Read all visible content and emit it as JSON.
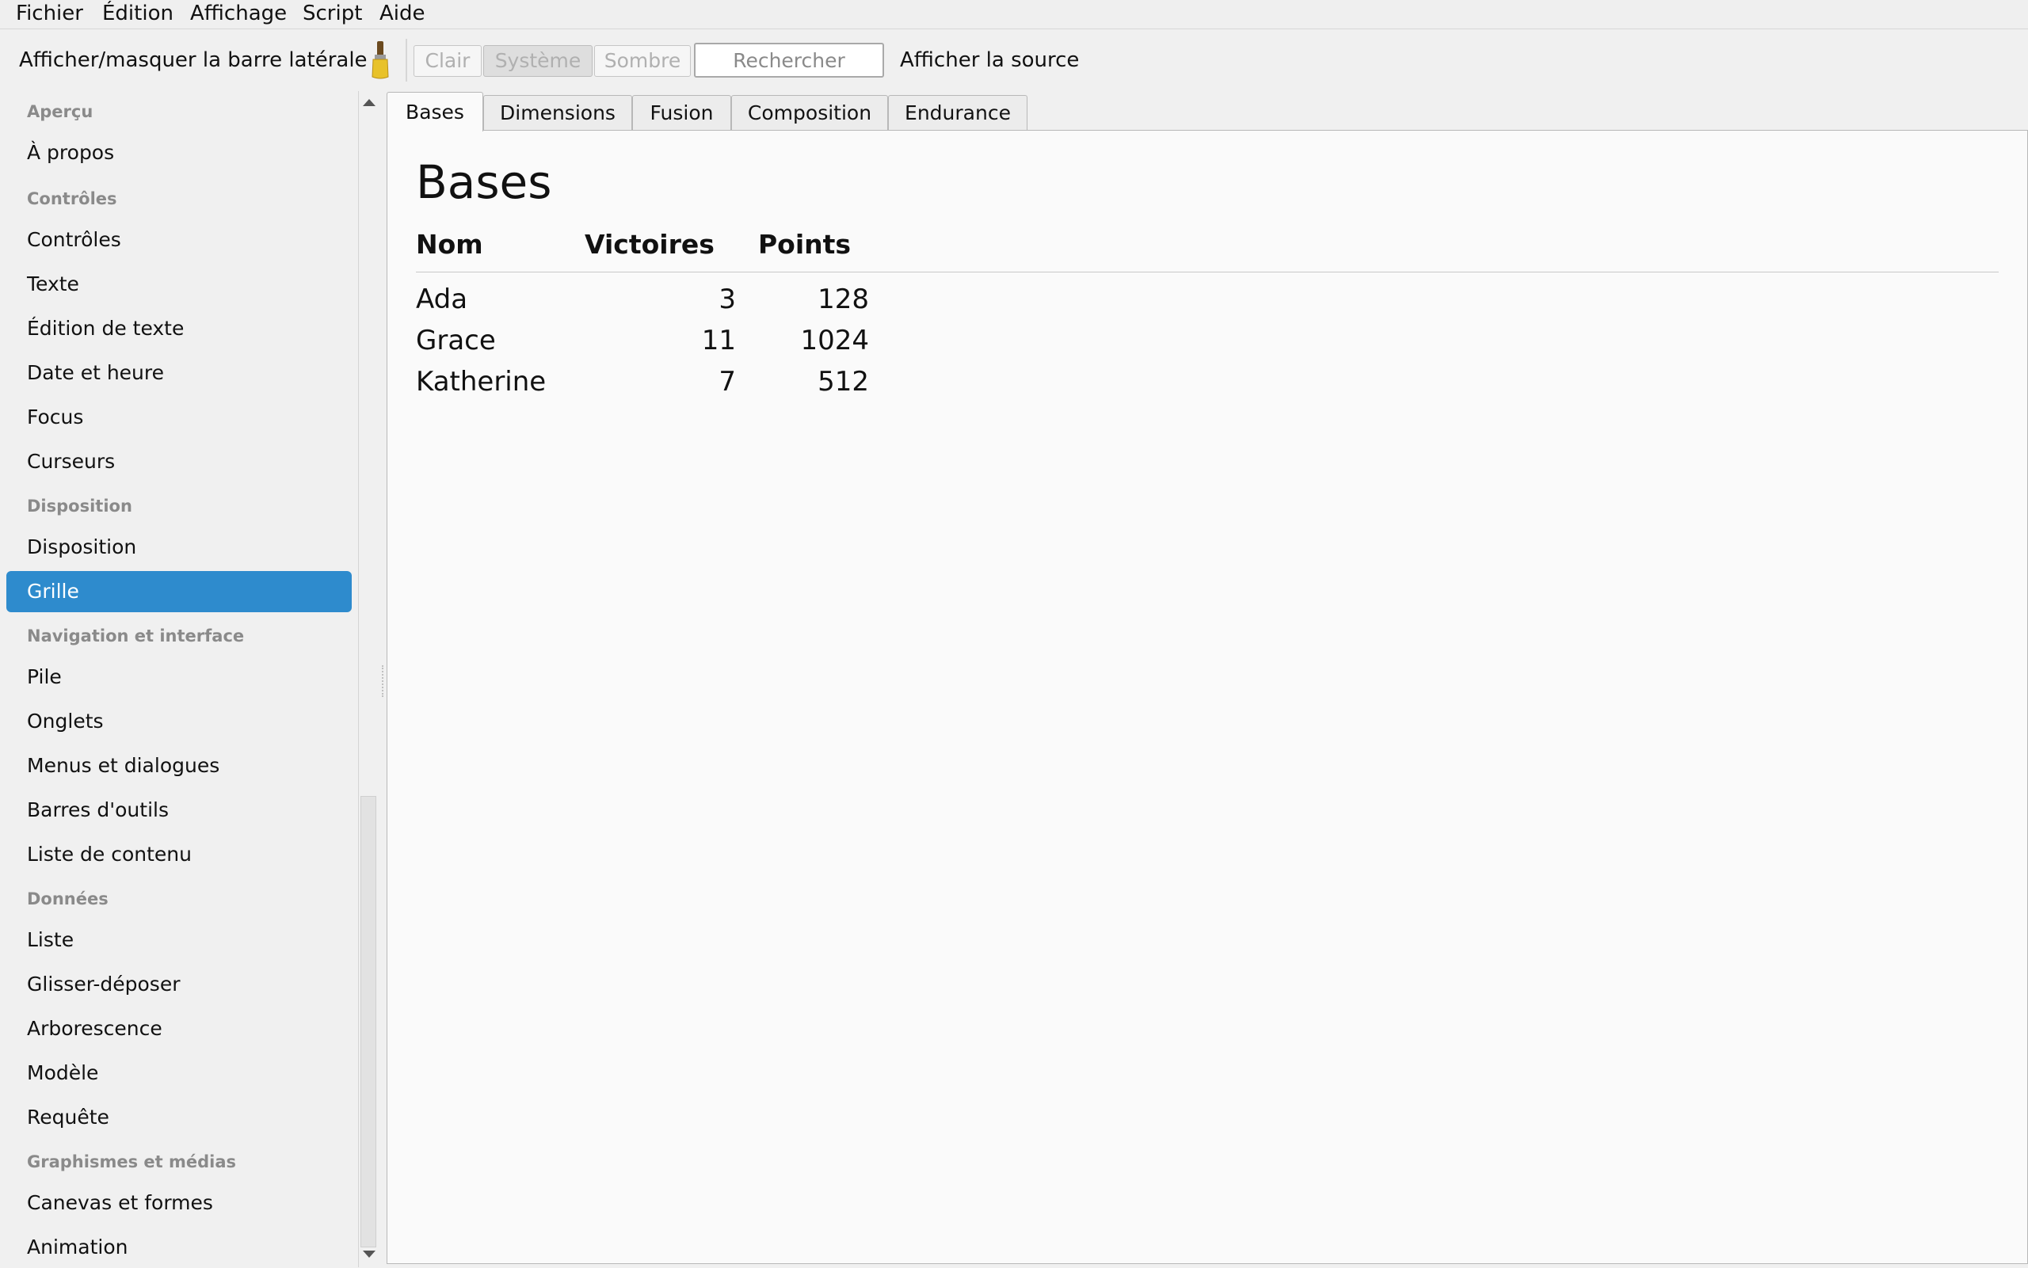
{
  "menubar": {
    "items": [
      "Fichier",
      "Édition",
      "Affichage",
      "Script",
      "Aide"
    ]
  },
  "toolbar": {
    "toggle_sidebar_label": "Afficher/masquer la barre latérale",
    "theme_buttons": [
      "Clair",
      "Système",
      "Sombre"
    ],
    "search_placeholder": "Rechercher",
    "view_source_label": "Afficher la source"
  },
  "sidebar": {
    "entries": [
      {
        "type": "section",
        "label": "Aperçu"
      },
      {
        "type": "item",
        "label": "À propos"
      },
      {
        "type": "section",
        "label": "Contrôles"
      },
      {
        "type": "item",
        "label": "Contrôles"
      },
      {
        "type": "item",
        "label": "Texte"
      },
      {
        "type": "item",
        "label": "Édition de texte"
      },
      {
        "type": "item",
        "label": "Date et heure"
      },
      {
        "type": "item",
        "label": "Focus"
      },
      {
        "type": "item",
        "label": "Curseurs"
      },
      {
        "type": "section",
        "label": "Disposition"
      },
      {
        "type": "item",
        "label": "Disposition"
      },
      {
        "type": "item",
        "label": "Grille",
        "selected": true
      },
      {
        "type": "section",
        "label": "Navigation et interface"
      },
      {
        "type": "item",
        "label": "Pile"
      },
      {
        "type": "item",
        "label": "Onglets"
      },
      {
        "type": "item",
        "label": "Menus et dialogues"
      },
      {
        "type": "item",
        "label": "Barres d'outils"
      },
      {
        "type": "item",
        "label": "Liste de contenu"
      },
      {
        "type": "section",
        "label": "Données"
      },
      {
        "type": "item",
        "label": "Liste"
      },
      {
        "type": "item",
        "label": "Glisser-déposer"
      },
      {
        "type": "item",
        "label": "Arborescence"
      },
      {
        "type": "item",
        "label": "Modèle"
      },
      {
        "type": "item",
        "label": "Requête"
      },
      {
        "type": "section",
        "label": "Graphismes et médias"
      },
      {
        "type": "item",
        "label": "Canevas et formes"
      },
      {
        "type": "item",
        "label": "Animation"
      }
    ],
    "selected_color": "#2e8bcd"
  },
  "tabs": {
    "items": [
      "Bases",
      "Dimensions",
      "Fusion",
      "Composition",
      "Endurance"
    ],
    "active": "Bases"
  },
  "page": {
    "title": "Bases",
    "table": {
      "headers": [
        "Nom",
        "Victoires",
        "Points"
      ],
      "rows": [
        [
          "Ada",
          "3",
          "128"
        ],
        [
          "Grace",
          "11",
          "1024"
        ],
        [
          "Katherine",
          "7",
          "512"
        ]
      ]
    }
  }
}
